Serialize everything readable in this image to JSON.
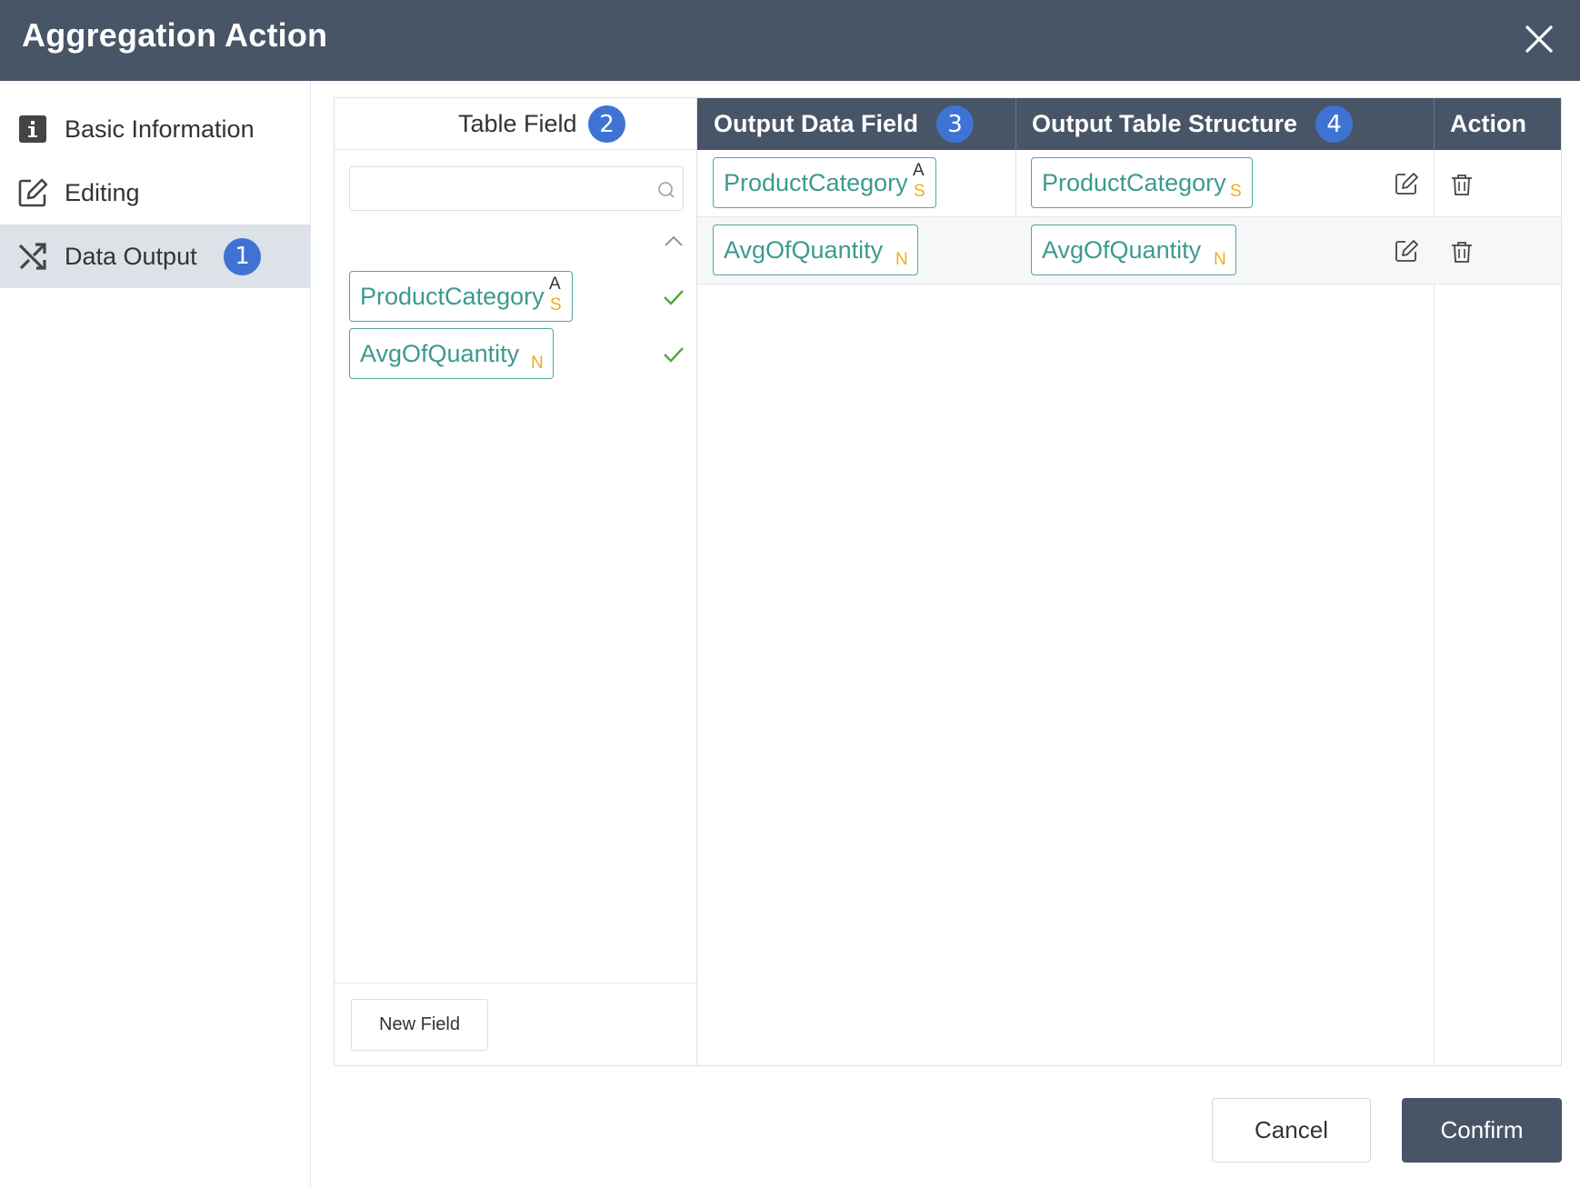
{
  "dialog": {
    "title": "Aggregation Action"
  },
  "sidebar": {
    "items": [
      {
        "label": "Basic Information",
        "icon": "info-icon",
        "active": false
      },
      {
        "label": "Editing",
        "icon": "edit-icon",
        "active": false
      },
      {
        "label": "Data Output",
        "icon": "shuffle-icon",
        "active": true,
        "badge": "1"
      }
    ]
  },
  "field_panel": {
    "header": "Table Field",
    "badge": "2",
    "search": {
      "value": "",
      "placeholder": ""
    },
    "fields": [
      {
        "name": "ProductCategory",
        "type_top": "A",
        "type": "S",
        "checked": true
      },
      {
        "name": "AvgOfQuantity",
        "type": "N",
        "checked": true
      }
    ],
    "new_field_label": "New Field"
  },
  "table": {
    "headers": {
      "output_data_field": "Output Data Field",
      "output_data_field_badge": "3",
      "output_table_structure": "Output Table Structure",
      "output_table_structure_badge": "4",
      "action": "Action"
    },
    "rows": [
      {
        "data_field": "ProductCategory",
        "data_type_top": "A",
        "data_type": "S",
        "structure_field": "ProductCategory",
        "structure_type": "S"
      },
      {
        "data_field": "AvgOfQuantity",
        "data_type": "N",
        "structure_field": "AvgOfQuantity",
        "structure_type": "N"
      }
    ]
  },
  "footer": {
    "cancel_label": "Cancel",
    "confirm_label": "Confirm"
  },
  "colors": {
    "header_bg": "#475566",
    "badge_bg": "#3f73d3",
    "tag_border": "#4ea89f",
    "tag_text": "#3c9a90",
    "type_badge": "#f0ad1c",
    "check": "#52a83a"
  }
}
